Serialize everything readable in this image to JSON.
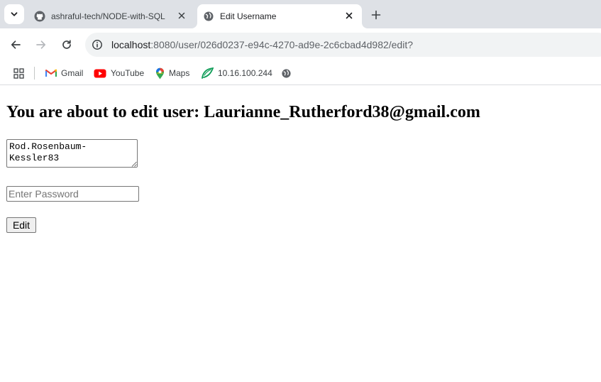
{
  "browser": {
    "tabs": [
      {
        "title": "ashraful-tech/NODE-with-SQL",
        "favicon": "github-icon",
        "active": false
      },
      {
        "title": "Edit Username",
        "favicon": "globe-icon",
        "active": true
      }
    ],
    "address_bar": {
      "host": "localhost",
      "path": ":8080/user/026d0237-e94c-4270-ad9e-2c6cbad4d982/edit?"
    },
    "bookmarks": [
      {
        "label": "Gmail",
        "icon": "gmail-icon"
      },
      {
        "label": "YouTube",
        "icon": "youtube-icon"
      },
      {
        "label": "Maps",
        "icon": "maps-pin-icon"
      },
      {
        "label": "10.16.100.244",
        "icon": "leaf-icon"
      },
      {
        "label": "",
        "icon": "globe-icon"
      }
    ]
  },
  "page": {
    "heading": "You are about to edit user: Laurianne_Rutherford38@gmail.com",
    "username_value": "Rod.Rosenbaum-Kessler83",
    "password_value": "",
    "password_placeholder": "Enter Password",
    "edit_label": "Edit"
  },
  "colors": {
    "tabstrip_bg": "#dee1e6",
    "omnibox_bg": "#f1f3f4",
    "youtube_red": "#ff0000",
    "gmail_red": "#ea4335",
    "maps_green": "#34a853",
    "leaf_green": "#0f9d58"
  }
}
